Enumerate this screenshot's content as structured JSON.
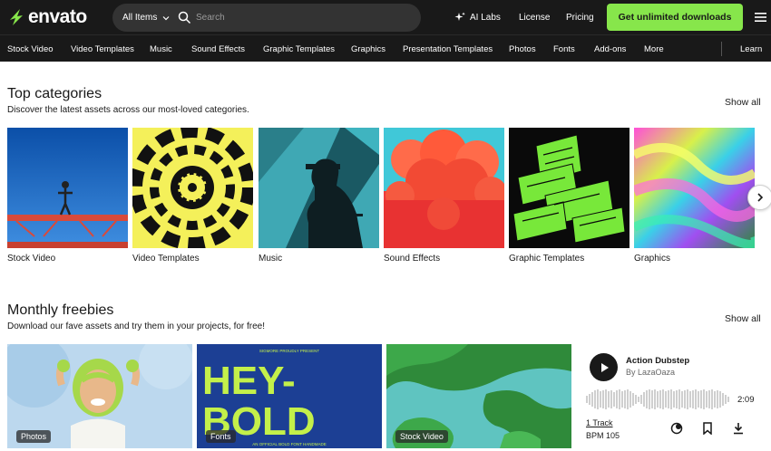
{
  "header": {
    "logo_text": "envato",
    "search_category": "All Items",
    "search_placeholder": "Search",
    "ai_labs": "AI Labs",
    "license": "License",
    "pricing": "Pricing",
    "cta": "Get unlimited downloads"
  },
  "category_nav": {
    "items": [
      "Stock Video",
      "Video Templates",
      "Music",
      "Sound Effects",
      "Graphic Templates",
      "Graphics",
      "Presentation Templates",
      "Photos",
      "Fonts",
      "Add-ons",
      "More"
    ],
    "learn": "Learn"
  },
  "top_categories": {
    "title": "Top categories",
    "subtitle": "Discover the latest assets across our most-loved categories.",
    "show_all": "Show all",
    "tiles": [
      {
        "label": "Stock Video"
      },
      {
        "label": "Video Templates"
      },
      {
        "label": "Music"
      },
      {
        "label": "Sound Effects"
      },
      {
        "label": "Graphic Templates"
      },
      {
        "label": "Graphics"
      }
    ]
  },
  "monthly_freebies": {
    "title": "Monthly freebies",
    "subtitle": "Download our fave assets and try them in your projects, for free!",
    "show_all": "Show all",
    "cards": [
      {
        "badge": "Photos"
      },
      {
        "badge": "Fonts",
        "headline_1": "HEY-",
        "headline_2": "BOLD",
        "top_text": "SIGMORE PROUDLY PRESENT",
        "bottom_text": "AN OFFICIAL BOLD FONT HANDMADE"
      },
      {
        "badge": "Stock Video"
      }
    ],
    "audio": {
      "title": "Action Dubstep",
      "author": "By LazaOaza",
      "duration": "2:09",
      "tracks": "1 Track",
      "bpm": "BPM 105"
    }
  },
  "colors": {
    "header_bg": "#191919",
    "accent_green": "#87e64b"
  }
}
